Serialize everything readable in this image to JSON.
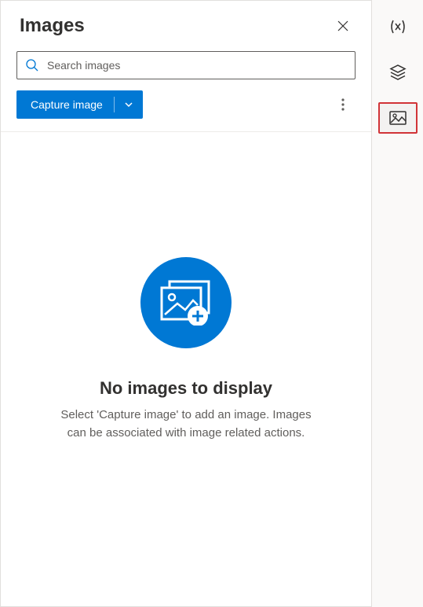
{
  "panel": {
    "title": "Images"
  },
  "search": {
    "placeholder": "Search images"
  },
  "toolbar": {
    "capture_label": "Capture image"
  },
  "empty_state": {
    "title": "No images to display",
    "description": "Select 'Capture image' to add an image. Images can be associated with image related actions."
  },
  "rail": {
    "variables": "variables",
    "layers": "layers",
    "images": "images"
  }
}
